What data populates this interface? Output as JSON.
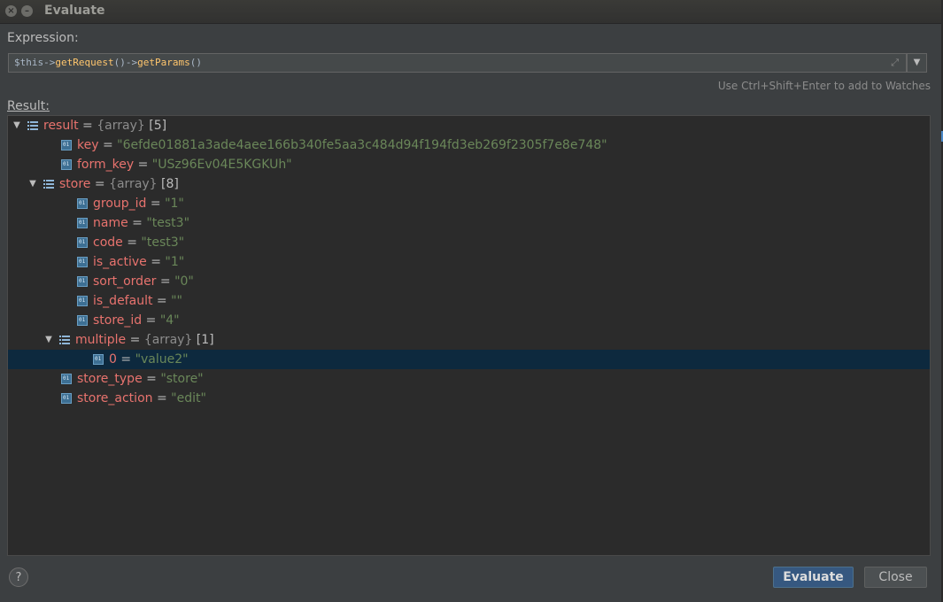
{
  "window": {
    "title": "Evaluate",
    "close_glyph": "×",
    "min_glyph": "–"
  },
  "expression": {
    "label": "Expression:",
    "parts": [
      "$this->",
      "getRequest",
      "()->",
      "getParams",
      "()"
    ],
    "dropdown_glyph": "▼",
    "expand_glyph": "⤢"
  },
  "hint": "Use Ctrl+Shift+Enter to add to Watches",
  "result": {
    "label": "Result:"
  },
  "tree": [
    {
      "depth": 0,
      "expanded": true,
      "kind": "array",
      "key": "result",
      "type": "{array}",
      "count": "[5]"
    },
    {
      "depth": 1,
      "kind": "value",
      "key": "key",
      "value": "\"6efde01881a3ade4aee166b340fe5aa3c484d94f194fd3eb269f2305f7e8e748\""
    },
    {
      "depth": 1,
      "kind": "value",
      "key": "form_key",
      "value": "\"USz96Ev04E5KGKUh\""
    },
    {
      "depth": 1,
      "expanded": true,
      "kind": "array",
      "key": "store",
      "type": "{array}",
      "count": "[8]"
    },
    {
      "depth": 2,
      "kind": "value",
      "key": "group_id",
      "value": "\"1\""
    },
    {
      "depth": 2,
      "kind": "value",
      "key": "name",
      "value": "\"test3\""
    },
    {
      "depth": 2,
      "kind": "value",
      "key": "code",
      "value": "\"test3\""
    },
    {
      "depth": 2,
      "kind": "value",
      "key": "is_active",
      "value": "\"1\""
    },
    {
      "depth": 2,
      "kind": "value",
      "key": "sort_order",
      "value": "\"0\""
    },
    {
      "depth": 2,
      "kind": "value",
      "key": "is_default",
      "value": "\"\""
    },
    {
      "depth": 2,
      "kind": "value",
      "key": "store_id",
      "value": "\"4\""
    },
    {
      "depth": 2,
      "expanded": true,
      "kind": "array",
      "key": "multiple",
      "type": "{array}",
      "count": "[1]"
    },
    {
      "depth": 3,
      "kind": "value",
      "key": "0",
      "value": "\"value2\"",
      "selected": true
    },
    {
      "depth": 1,
      "kind": "value",
      "key": "store_type",
      "value": "\"store\""
    },
    {
      "depth": 1,
      "kind": "value",
      "key": "store_action",
      "value": "\"edit\""
    }
  ],
  "buttons": {
    "help": "?",
    "evaluate": "Evaluate",
    "close": "Close"
  }
}
